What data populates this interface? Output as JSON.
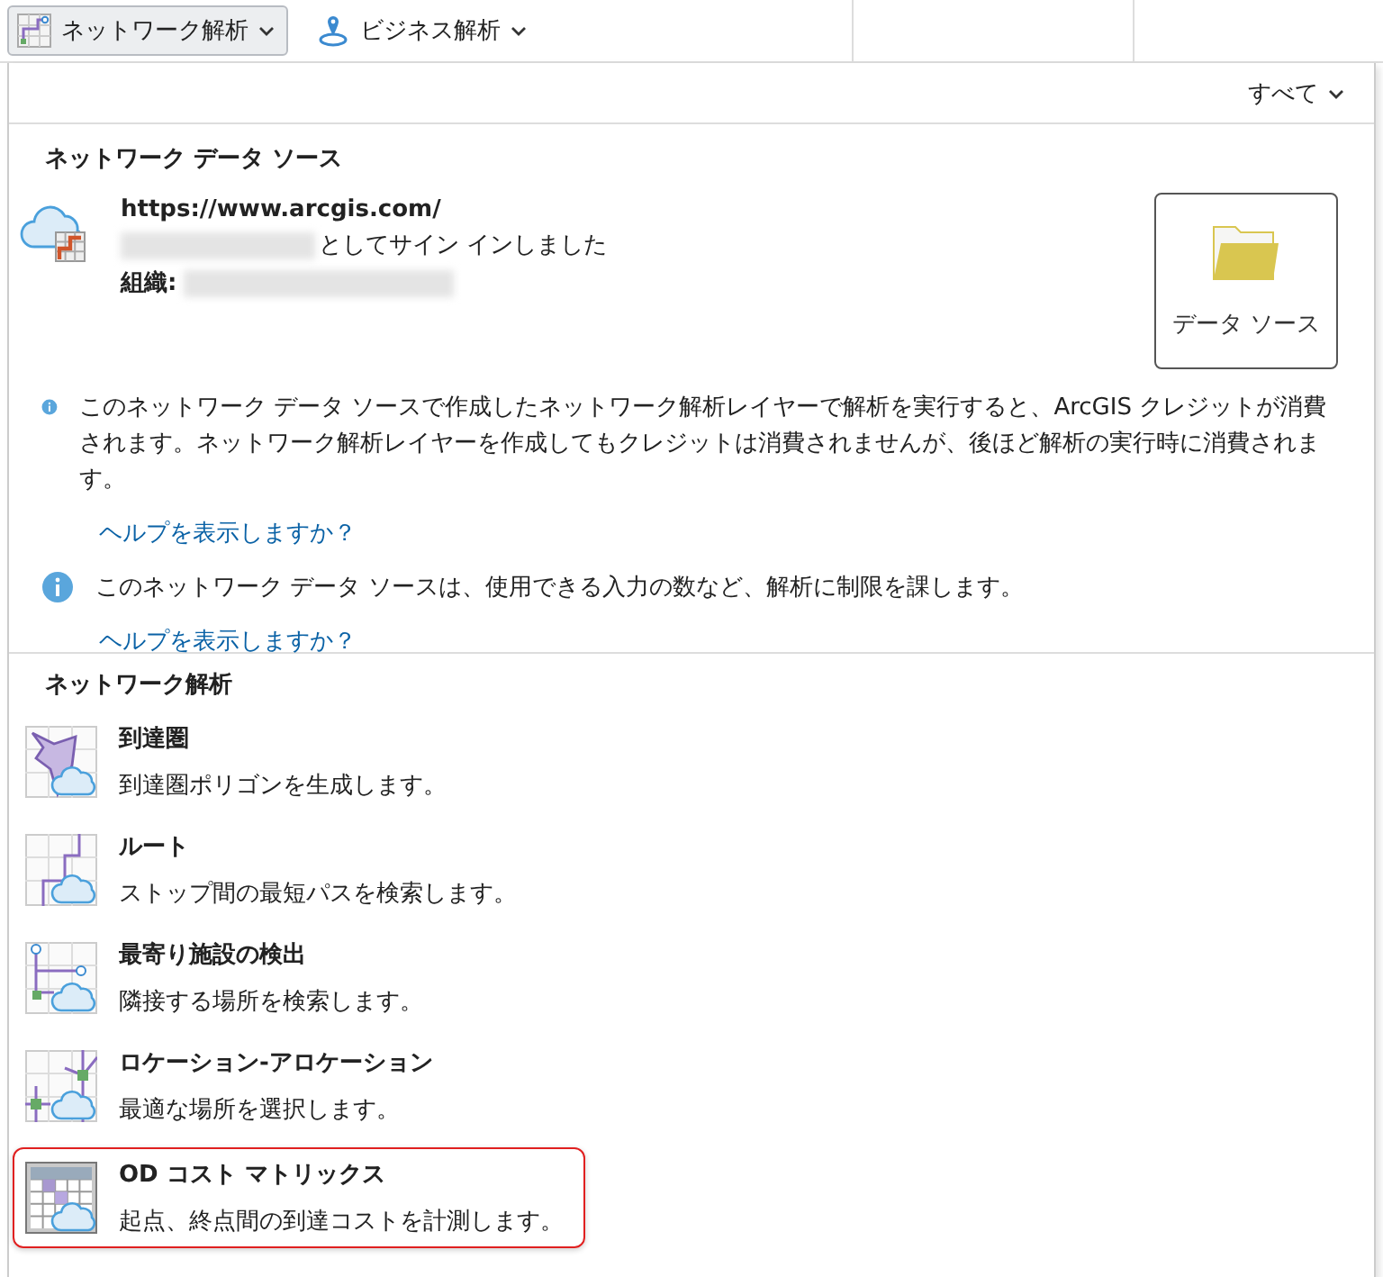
{
  "toolbar": {
    "buttons": [
      {
        "label": "ネットワーク解析",
        "selected": true,
        "kind": "network"
      },
      {
        "label": "ビジネス解析",
        "selected": false,
        "kind": "business"
      }
    ]
  },
  "panel": {
    "filter": {
      "label": "すべて"
    },
    "data_source": {
      "title": "ネットワーク データ ソース",
      "url": "https://www.arcgis.com/",
      "signed_in": "としてサイン インしました",
      "org_label": "組織:",
      "button": "データ ソース",
      "notes": [
        {
          "text": "このネットワーク データ ソースで作成したネットワーク解析レイヤーで解析を実行すると、ArcGIS クレジットが消費されます。ネットワーク解析レイヤーを作成してもクレジットは消費されませんが、後ほど解析の実行時に消費されます。",
          "link": "ヘルプを表示しますか？"
        },
        {
          "text": "このネットワーク データ ソースは、使用できる入力の数など、解析に制限を課します。",
          "link": "ヘルプを表示しますか？"
        }
      ]
    },
    "analysis": {
      "title": "ネットワーク解析",
      "items": [
        {
          "kind": "service_area",
          "title": "到達圏",
          "description": "到達圏ポリゴンを生成します。",
          "highlighted": false
        },
        {
          "kind": "route",
          "title": "ルート",
          "description": "ストップ間の最短パスを検索します。",
          "highlighted": false
        },
        {
          "kind": "closest_facility",
          "title": "最寄り施設の検出",
          "description": "隣接する場所を検索します。",
          "highlighted": false
        },
        {
          "kind": "location_allocation",
          "title": "ロケーション-アロケーション",
          "description": "最適な場所を選択します。",
          "highlighted": false
        },
        {
          "kind": "od_matrix",
          "title": "OD コスト マトリックス",
          "description": "起点、終点間の到達コストを計測します。",
          "highlighted": true
        }
      ]
    }
  }
}
